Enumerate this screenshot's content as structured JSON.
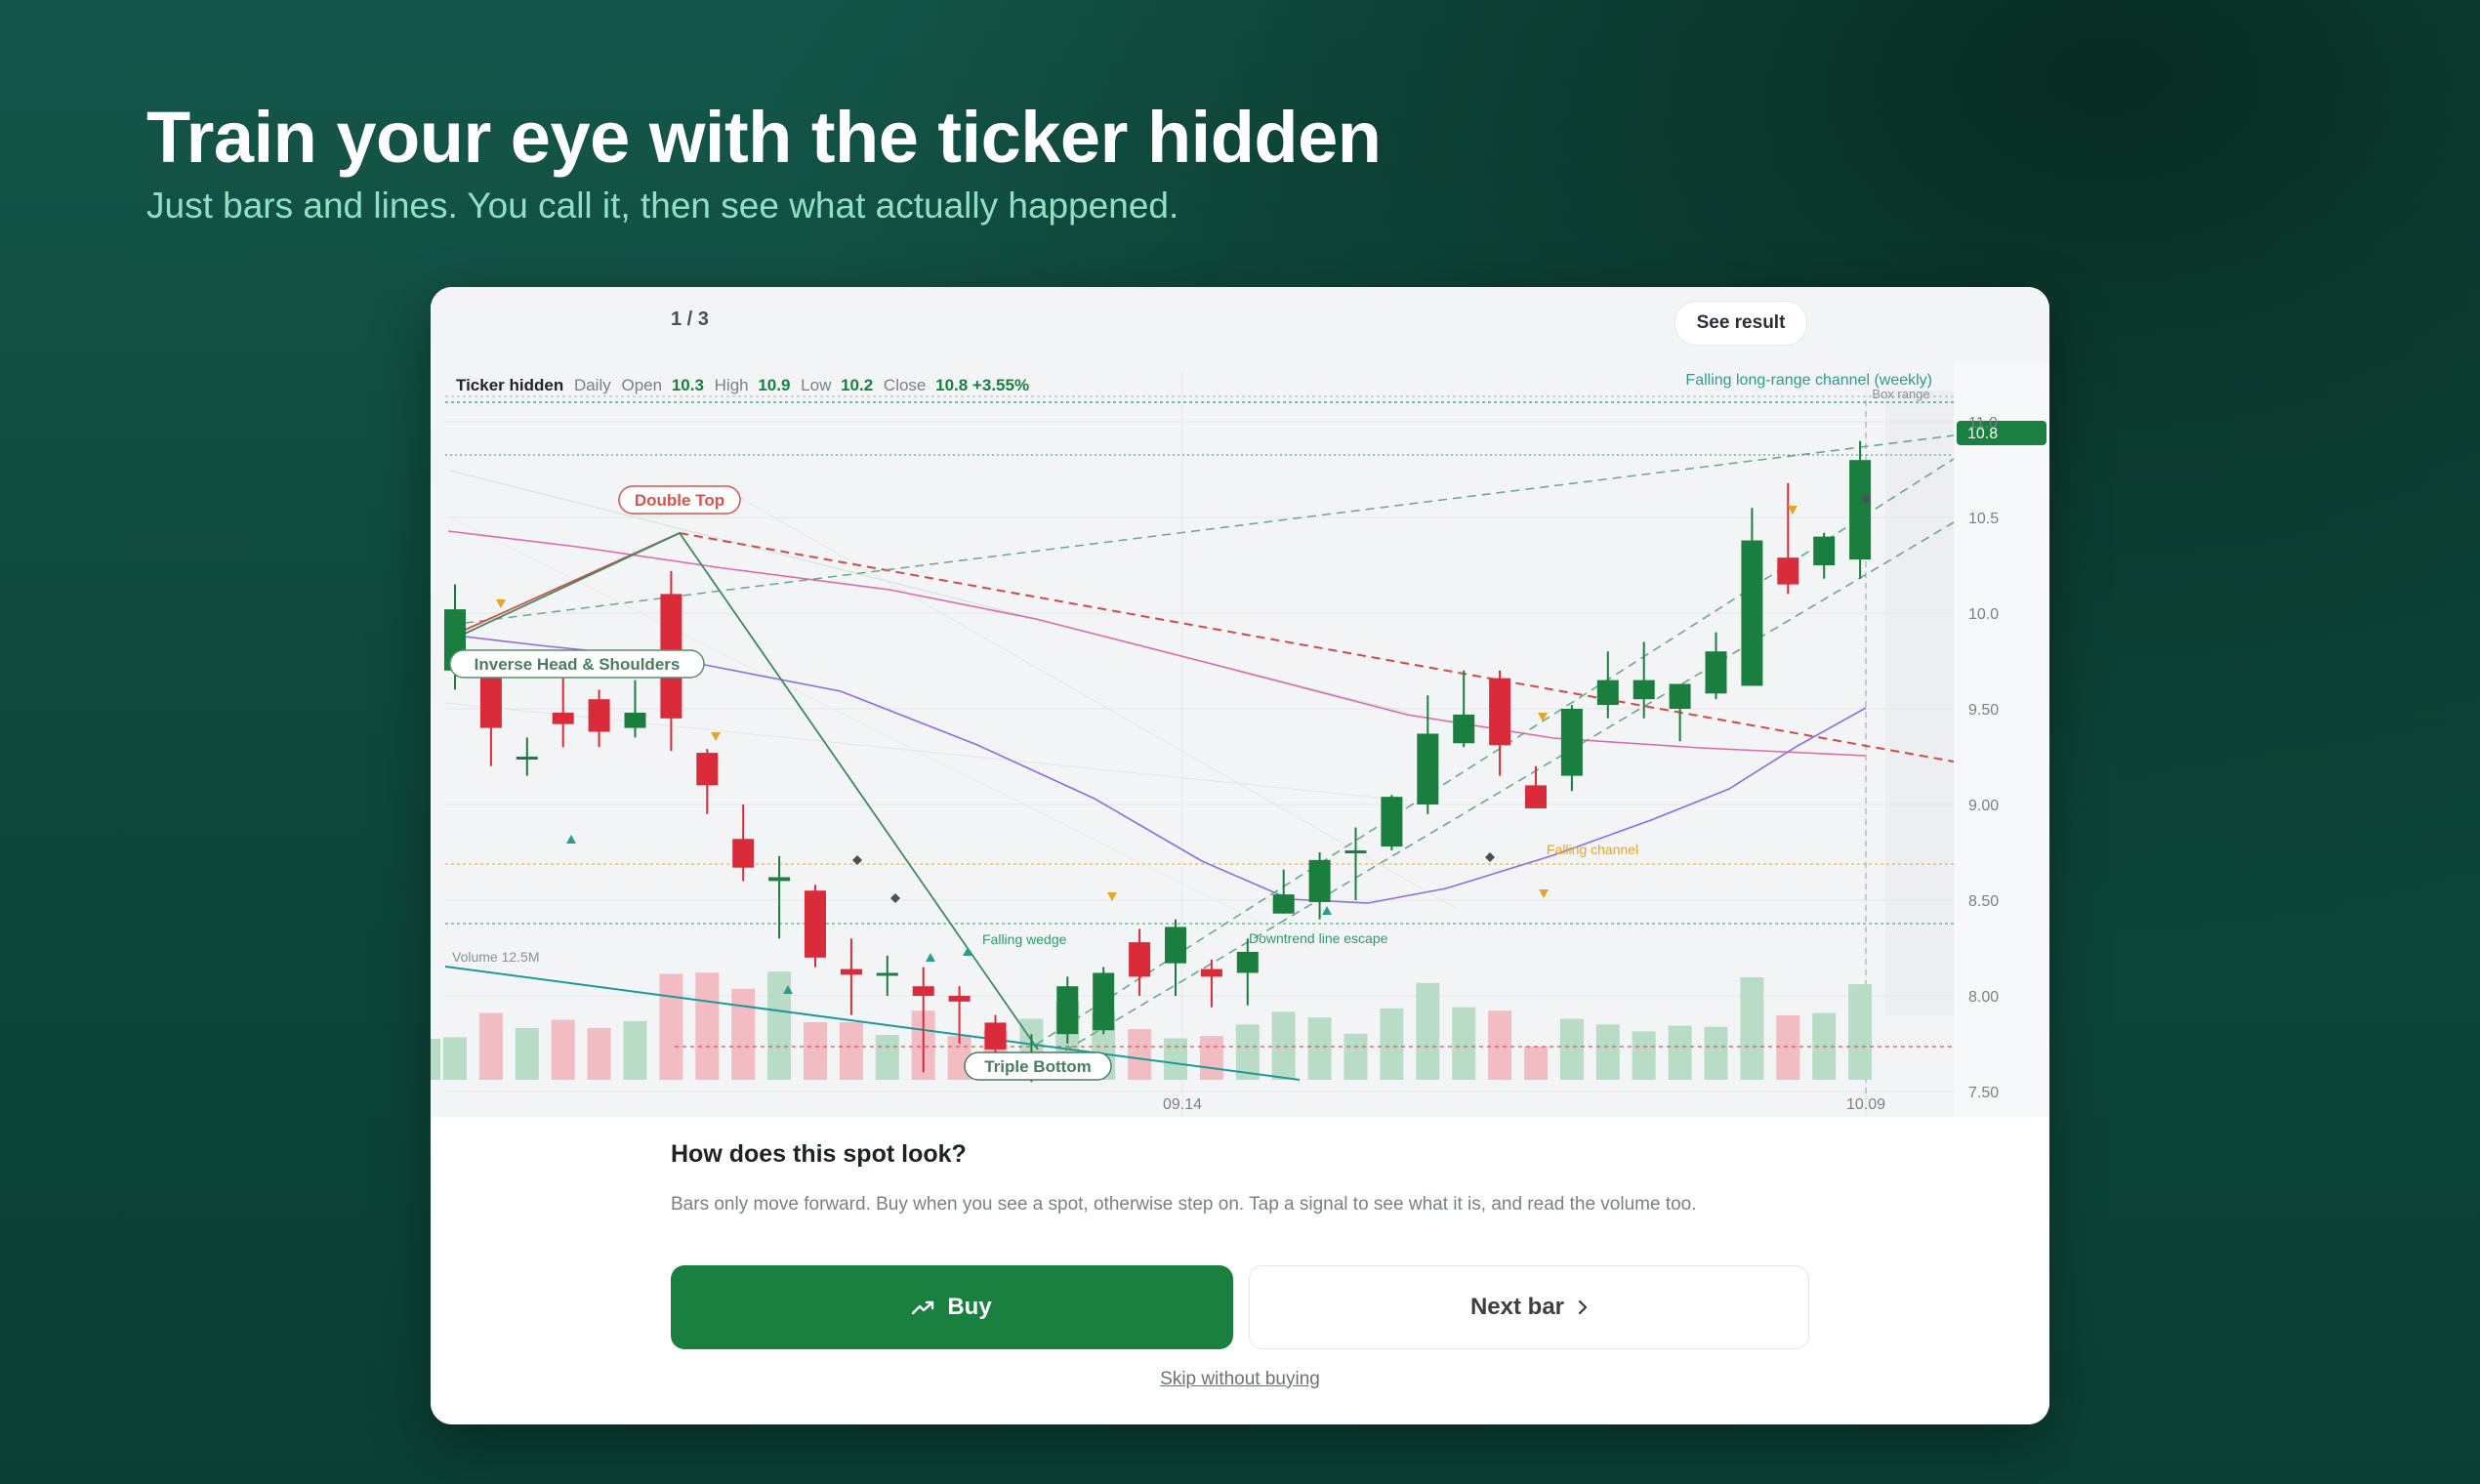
{
  "hero": {
    "title": "Train your eye with the ticker hidden",
    "subtitle": "Just bars and lines. You call it, then see what actually happened."
  },
  "card": {
    "counter": "1 / 3",
    "see_result_label": "See result"
  },
  "chart": {
    "header": {
      "name": "Ticker hidden",
      "interval": "Daily",
      "open_label": "Open",
      "open": "10.3",
      "high_label": "High",
      "high": "10.9",
      "low_label": "Low",
      "low": "10.2",
      "close_label": "Close",
      "close": "10.8 +3.55%"
    },
    "price_tag": "10.8",
    "volume_label": "Volume 12.5M",
    "pattern_labels": {
      "double_top": "Double Top",
      "inverse_hs": "Inverse Head & Shoulders",
      "triple_bottom": "Triple Bottom"
    },
    "annotations": {
      "channel_weekly": "Falling long-range channel (weekly)",
      "box_range": "Box range",
      "falling_channel": "Falling channel",
      "falling_wedge": "Falling wedge",
      "downtrend_escape": "Downtrend line escape"
    },
    "colors": {
      "up": "#1a7f3e",
      "down": "#d92b3a",
      "accent": "#19803f"
    }
  },
  "chart_data": {
    "type": "candlestick",
    "title": "",
    "y_ticks": [
      "11.0",
      "10.5",
      "10.0",
      "9.50",
      "9.00",
      "8.50",
      "8.00",
      "7.50"
    ],
    "x_ticks": [
      "09.14",
      "10.09"
    ],
    "ylim": [
      7.4,
      11.1
    ],
    "candles": [
      {
        "o": 9.7,
        "h": 10.15,
        "l": 9.6,
        "c": 10.02
      },
      {
        "o": 9.68,
        "h": 9.75,
        "l": 9.2,
        "c": 9.4
      },
      {
        "o": 9.25,
        "h": 9.35,
        "l": 9.15,
        "c": 9.25
      },
      {
        "o": 9.48,
        "h": 9.7,
        "l": 9.3,
        "c": 9.42
      },
      {
        "o": 9.55,
        "h": 9.6,
        "l": 9.3,
        "c": 9.38
      },
      {
        "o": 9.4,
        "h": 9.65,
        "l": 9.35,
        "c": 9.48
      },
      {
        "o": 10.1,
        "h": 10.22,
        "l": 9.28,
        "c": 9.45
      },
      {
        "o": 9.27,
        "h": 9.29,
        "l": 8.95,
        "c": 9.1
      },
      {
        "o": 8.82,
        "h": 9.0,
        "l": 8.6,
        "c": 8.67
      },
      {
        "o": 8.6,
        "h": 8.73,
        "l": 8.3,
        "c": 8.62
      },
      {
        "o": 8.55,
        "h": 8.58,
        "l": 8.15,
        "c": 8.2
      },
      {
        "o": 8.14,
        "h": 8.3,
        "l": 7.9,
        "c": 8.11
      },
      {
        "o": 8.12,
        "h": 8.21,
        "l": 8.0,
        "c": 8.12
      },
      {
        "o": 8.05,
        "h": 8.15,
        "l": 7.6,
        "c": 8.0
      },
      {
        "o": 8.0,
        "h": 8.05,
        "l": 7.75,
        "c": 7.97
      },
      {
        "o": 7.86,
        "h": 7.9,
        "l": 7.68,
        "c": 7.72
      },
      {
        "o": 7.68,
        "h": 7.8,
        "l": 7.55,
        "c": 7.7
      },
      {
        "o": 7.8,
        "h": 8.1,
        "l": 7.75,
        "c": 8.05
      },
      {
        "o": 7.82,
        "h": 8.15,
        "l": 7.8,
        "c": 8.12
      },
      {
        "o": 8.28,
        "h": 8.35,
        "l": 8.0,
        "c": 8.1
      },
      {
        "o": 8.17,
        "h": 8.4,
        "l": 8.0,
        "c": 8.36
      },
      {
        "o": 8.14,
        "h": 8.19,
        "l": 7.94,
        "c": 8.1
      },
      {
        "o": 8.12,
        "h": 8.3,
        "l": 7.95,
        "c": 8.23
      },
      {
        "o": 8.43,
        "h": 8.66,
        "l": 8.43,
        "c": 8.53
      },
      {
        "o": 8.49,
        "h": 8.75,
        "l": 8.4,
        "c": 8.71
      },
      {
        "o": 8.76,
        "h": 8.88,
        "l": 8.5,
        "c": 8.76
      },
      {
        "o": 8.78,
        "h": 9.05,
        "l": 8.76,
        "c": 9.04
      },
      {
        "o": 9.0,
        "h": 9.57,
        "l": 8.95,
        "c": 9.37
      },
      {
        "o": 9.32,
        "h": 9.7,
        "l": 9.3,
        "c": 9.47
      },
      {
        "o": 9.66,
        "h": 9.7,
        "l": 9.15,
        "c": 9.31
      },
      {
        "o": 9.1,
        "h": 9.2,
        "l": 9.0,
        "c": 8.98
      },
      {
        "o": 9.15,
        "h": 9.52,
        "l": 9.07,
        "c": 9.5
      },
      {
        "o": 9.52,
        "h": 9.8,
        "l": 9.45,
        "c": 9.65
      },
      {
        "o": 9.55,
        "h": 9.85,
        "l": 9.45,
        "c": 9.65
      },
      {
        "o": 9.5,
        "h": 9.62,
        "l": 9.33,
        "c": 9.63
      },
      {
        "o": 9.58,
        "h": 9.9,
        "l": 9.55,
        "c": 9.8
      },
      {
        "o": 9.62,
        "h": 10.55,
        "l": 9.62,
        "c": 10.38
      },
      {
        "o": 10.29,
        "h": 10.68,
        "l": 10.1,
        "c": 10.15
      },
      {
        "o": 10.25,
        "h": 10.42,
        "l": 10.18,
        "c": 10.4
      },
      {
        "o": 10.28,
        "h": 10.9,
        "l": 10.18,
        "c": 10.8
      }
    ],
    "volumes": [
      0.37,
      0.58,
      0.45,
      0.52,
      0.45,
      0.51,
      0.92,
      0.93,
      0.79,
      0.94,
      0.5,
      0.5,
      0.39,
      0.6,
      0.38,
      0.43,
      0.53,
      0.68,
      0.58,
      0.44,
      0.36,
      0.38,
      0.48,
      0.59,
      0.54,
      0.4,
      0.62,
      0.84,
      0.63,
      0.6,
      0.29,
      0.53,
      0.48,
      0.42,
      0.47,
      0.46,
      0.89,
      0.56,
      0.58,
      0.83
    ]
  },
  "prompt": {
    "title": "How does this spot look?",
    "description": "Bars only move forward. Buy when you see a spot, otherwise step on. Tap a signal to see what it is, and read the volume too.",
    "buy_label": "Buy",
    "next_label": "Next bar",
    "skip_label": "Skip without buying"
  }
}
